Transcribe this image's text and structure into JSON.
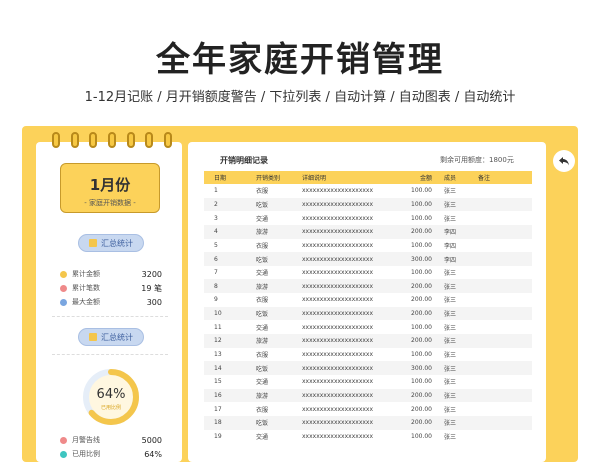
{
  "hero": {
    "title": "全年家庭开销管理",
    "subtitle": "1-12月记账 / 月开销额度警告 / 下拉列表 / 自动计算 / 自动图表 / 自动统计"
  },
  "left_panel": {
    "month": "1月份",
    "month_sub": "-  家庭开销数据  -",
    "summary_button_1": "汇总统计",
    "summary_button_2": "汇总统计",
    "stats": [
      {
        "label": "累计金额",
        "value": "3200",
        "color": "#f4c64c"
      },
      {
        "label": "累计笔数",
        "value": "19 笔",
        "color": "#ef8a8a"
      },
      {
        "label": "最大金额",
        "value": "300",
        "color": "#7aa6e0"
      }
    ],
    "gauge": {
      "percent_text": "64%",
      "label": "已用比例",
      "percent": 64
    },
    "budget_stats": [
      {
        "label": "月警告线",
        "value": "5000",
        "color": "#ef8a8a"
      },
      {
        "label": "已用比例",
        "value": "64%",
        "color": "#3ec5c0"
      }
    ]
  },
  "table": {
    "title": "开销明细记录",
    "budget_text": "剩余可用额度：1800元",
    "headers": [
      "日期",
      "开销类别",
      "详细说明",
      "金额",
      "成员",
      "备注"
    ],
    "rows": [
      [
        "1",
        "衣服",
        "xxxxxxxxxxxxxxxxxxxx",
        "100.00",
        "张三",
        ""
      ],
      [
        "2",
        "吃饭",
        "xxxxxxxxxxxxxxxxxxxx",
        "100.00",
        "张三",
        ""
      ],
      [
        "3",
        "交通",
        "xxxxxxxxxxxxxxxxxxxx",
        "100.00",
        "张三",
        ""
      ],
      [
        "4",
        "旅游",
        "xxxxxxxxxxxxxxxxxxxx",
        "200.00",
        "李四",
        ""
      ],
      [
        "5",
        "衣服",
        "xxxxxxxxxxxxxxxxxxxx",
        "100.00",
        "李四",
        ""
      ],
      [
        "6",
        "吃饭",
        "xxxxxxxxxxxxxxxxxxxx",
        "300.00",
        "李四",
        ""
      ],
      [
        "7",
        "交通",
        "xxxxxxxxxxxxxxxxxxxx",
        "100.00",
        "张三",
        ""
      ],
      [
        "8",
        "旅游",
        "xxxxxxxxxxxxxxxxxxxx",
        "200.00",
        "张三",
        ""
      ],
      [
        "9",
        "衣服",
        "xxxxxxxxxxxxxxxxxxxx",
        "200.00",
        "张三",
        ""
      ],
      [
        "10",
        "吃饭",
        "xxxxxxxxxxxxxxxxxxxx",
        "200.00",
        "张三",
        ""
      ],
      [
        "11",
        "交通",
        "xxxxxxxxxxxxxxxxxxxx",
        "100.00",
        "张三",
        ""
      ],
      [
        "12",
        "旅游",
        "xxxxxxxxxxxxxxxxxxxx",
        "200.00",
        "张三",
        ""
      ],
      [
        "13",
        "衣服",
        "xxxxxxxxxxxxxxxxxxxx",
        "100.00",
        "张三",
        ""
      ],
      [
        "14",
        "吃饭",
        "xxxxxxxxxxxxxxxxxxxx",
        "300.00",
        "张三",
        ""
      ],
      [
        "15",
        "交通",
        "xxxxxxxxxxxxxxxxxxxx",
        "100.00",
        "张三",
        ""
      ],
      [
        "16",
        "旅游",
        "xxxxxxxxxxxxxxxxxxxx",
        "200.00",
        "张三",
        ""
      ],
      [
        "17",
        "衣服",
        "xxxxxxxxxxxxxxxxxxxx",
        "200.00",
        "张三",
        ""
      ],
      [
        "18",
        "吃饭",
        "xxxxxxxxxxxxxxxxxxxx",
        "200.00",
        "张三",
        ""
      ],
      [
        "19",
        "交通",
        "xxxxxxxxxxxxxxxxxxxx",
        "100.00",
        "张三",
        ""
      ]
    ]
  },
  "icons": {
    "back": "back-arrow-icon",
    "summary": "document-icon"
  },
  "colors": {
    "accent": "#fcd25a",
    "button": "#c8d8f0",
    "row_alt": "#f4f4f4"
  }
}
